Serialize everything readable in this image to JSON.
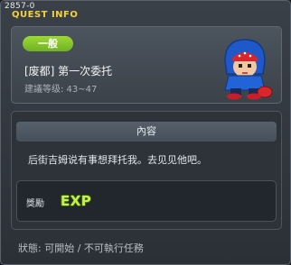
{
  "window": {
    "id_label": "2857-0",
    "title": "QUEST INFO"
  },
  "quest": {
    "category": "一般",
    "name": "[废都] 第一次委托",
    "level_range": "建議等级: 43~47"
  },
  "content": {
    "header": "內容",
    "text": "后街吉姆说有事想拜托我。去见见他吧。"
  },
  "reward": {
    "label": "獎勵",
    "exp_text": "EXP"
  },
  "status": {
    "text": "狀態: 可開始 / 不可執行任務"
  },
  "icons": {
    "npc": "npc-portrait-icon"
  },
  "colors": {
    "title": "#f3d23c",
    "badge": "#8cc82e",
    "exp": "#c9f04a"
  }
}
